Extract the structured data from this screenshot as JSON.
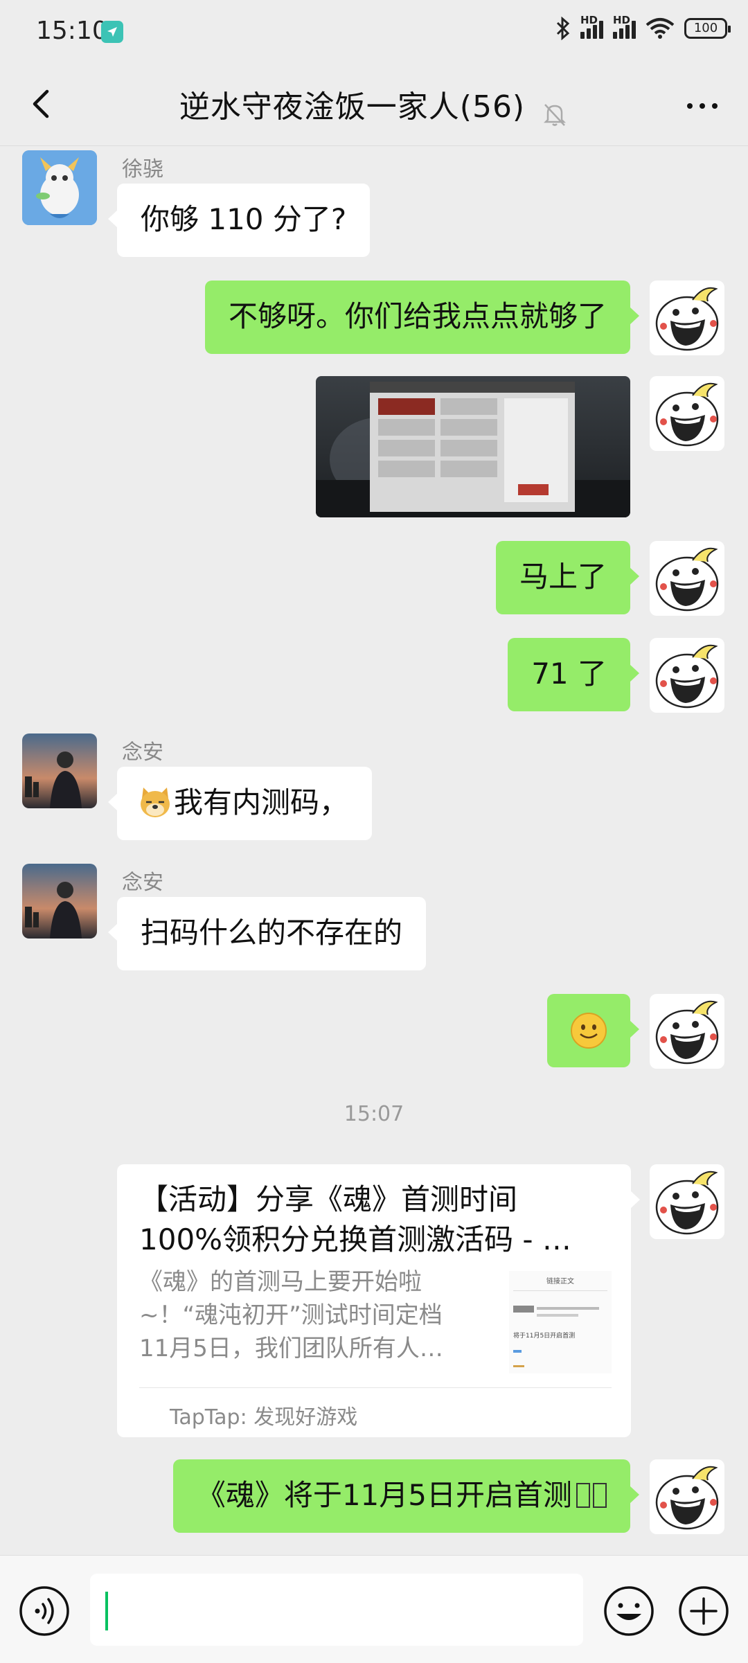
{
  "status_bar": {
    "time": "15:10",
    "battery": "100",
    "signal_label": "HD"
  },
  "nav": {
    "title": "逆水守夜淦饭一家人(56)"
  },
  "messages": {
    "m1": {
      "sender": "徐骁",
      "text": "你够 110 分了?"
    },
    "m2": {
      "text": "不够呀。你们给我点点就够了"
    },
    "m4": {
      "text": "马上了"
    },
    "m5": {
      "text": "71 了"
    },
    "m6": {
      "sender": "念安",
      "text": "我有内测码，"
    },
    "m7": {
      "sender": "念安",
      "text": "扫码什么的不存在的"
    },
    "ts": "15:07",
    "card": {
      "title_line1": "【活动】分享《魂》首测时间",
      "title_line2": "100%领积分兑换首测激活码 - …",
      "desc_line1": "《魂》的首测马上要开始啦",
      "desc_line2": "~！“魂沌初开”测试时间定档",
      "desc_line3": "11月5日，我们团队所有人…",
      "thumb_heading": "链接正文",
      "thumb_caption": "将于11月5日开启首测",
      "source": "TapTap: 发现好游戏"
    },
    "m10": {
      "text": "《魂》将于11月5日开启首测"
    }
  },
  "colors": {
    "green_bubble": "#95ec69",
    "background": "#ededed",
    "accent": "#07c160"
  }
}
